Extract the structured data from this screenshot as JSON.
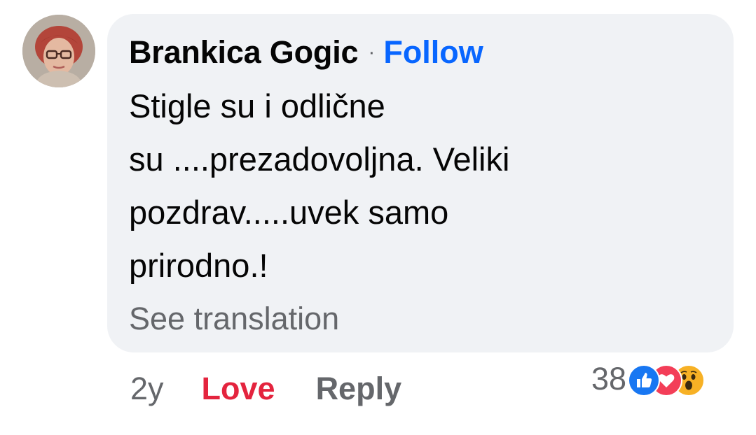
{
  "comment": {
    "author": "Brankica Gogic",
    "separator": "·",
    "follow_label": "Follow",
    "text_lines": [
      "Stigle su i odlične",
      "su ....prezadovoljna. Veliki",
      "pozdrav.....uvek samo",
      "prirodno.!"
    ],
    "see_translation_label": "See translation"
  },
  "actions": {
    "time": "2y",
    "love_label": "Love",
    "reply_label": "Reply"
  },
  "reactions": {
    "count": "38",
    "icons": [
      "like-icon",
      "love-icon",
      "wow-icon"
    ]
  },
  "colors": {
    "follow_blue": "#0866ff",
    "love_red": "#e4243e",
    "secondary_gray": "#65676b",
    "bubble_bg": "#f0f2f5",
    "text_black": "#050505"
  }
}
